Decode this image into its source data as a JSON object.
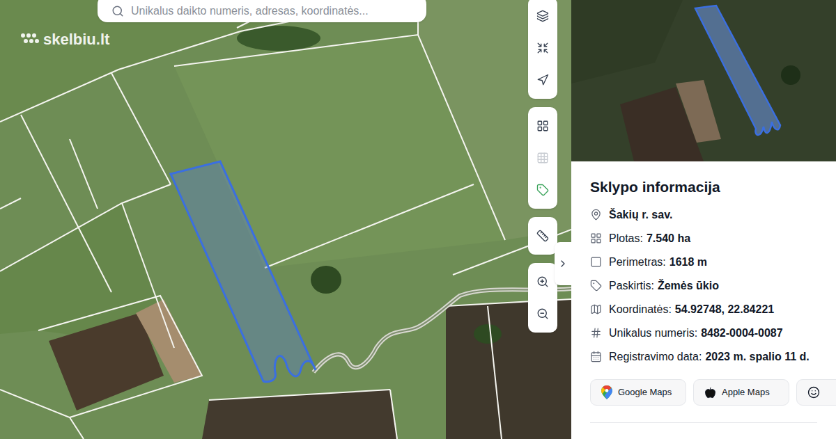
{
  "logo": {
    "text": "skelbiu.lt"
  },
  "search": {
    "placeholder": "Unikalus daikto numeris, adresas, koordinatės..."
  },
  "toolbar": [
    [
      {
        "kind": "layers",
        "active": false,
        "disabled": false
      },
      {
        "kind": "collapse",
        "active": false,
        "disabled": false
      },
      {
        "kind": "locate",
        "active": false,
        "disabled": false
      }
    ],
    [
      {
        "kind": "parcels",
        "active": false,
        "disabled": false
      },
      {
        "kind": "grid",
        "active": false,
        "disabled": true
      },
      {
        "kind": "tag",
        "active": true,
        "disabled": false
      }
    ],
    [
      {
        "kind": "ruler",
        "active": false,
        "disabled": false
      }
    ],
    [
      {
        "kind": "zoom-in",
        "active": false,
        "disabled": false
      },
      {
        "kind": "zoom-out",
        "active": false,
        "disabled": false
      }
    ]
  ],
  "panel": {
    "title": "Sklypo informacija",
    "rows": [
      {
        "kind": "location",
        "label": "",
        "value": "Šakių r. sav."
      },
      {
        "kind": "area",
        "label": "Plotas:",
        "value": "7.540 ha"
      },
      {
        "kind": "perimeter",
        "label": "Perimetras:",
        "value": "1618 m"
      },
      {
        "kind": "purpose",
        "label": "Paskirtis:",
        "value": "Žemės ūkio"
      },
      {
        "kind": "coordinates",
        "label": "Koordinatės:",
        "value": "54.92748, 22.84221"
      },
      {
        "kind": "number",
        "label": "Unikalus numeris:",
        "value": "8482-0004-0087"
      },
      {
        "kind": "date",
        "label": "Registravimo data:",
        "value": "2023 m. spalio 11 d."
      }
    ],
    "buttons": [
      {
        "kind": "google",
        "label": "Google Maps"
      },
      {
        "kind": "apple",
        "label": "Apple Maps"
      },
      {
        "kind": "waze",
        "label": ""
      }
    ]
  }
}
